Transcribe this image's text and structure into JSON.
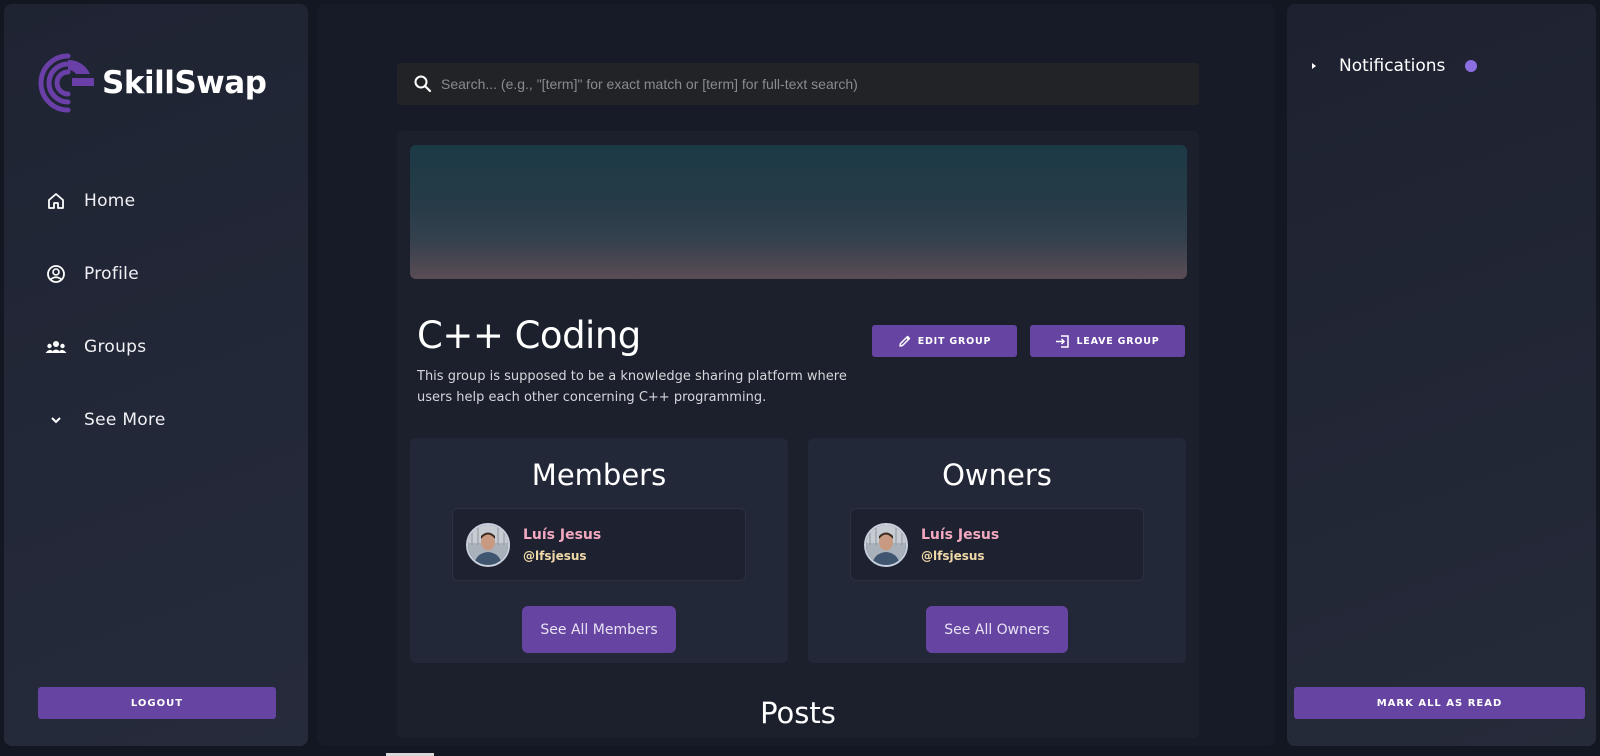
{
  "app": {
    "name": "SkillSwap",
    "accent_color": "#6644a2"
  },
  "sidebar": {
    "items": [
      {
        "label": "Home",
        "icon": "home-icon"
      },
      {
        "label": "Profile",
        "icon": "user-circle-icon"
      },
      {
        "label": "Groups",
        "icon": "users-icon"
      },
      {
        "label": "See More",
        "icon": "chevron-down-icon"
      }
    ],
    "logout_label": "LOGOUT"
  },
  "search": {
    "placeholder": "Search... (e.g., \"[term]\" for exact match or [term] for full-text search)",
    "value": ""
  },
  "group": {
    "title": "C++ Coding",
    "description": "This group is supposed to be a knowledge sharing platform where users help each other concerning C++ programming.",
    "edit_label": "EDIT GROUP",
    "leave_label": "LEAVE GROUP"
  },
  "members": {
    "title": "Members",
    "users": [
      {
        "name": "Luís Jesus",
        "handle": "@lfsjesus"
      }
    ],
    "see_all_label": "See All Members"
  },
  "owners": {
    "title": "Owners",
    "users": [
      {
        "name": "Luís Jesus",
        "handle": "@lfsjesus"
      }
    ],
    "see_all_label": "See All Owners"
  },
  "posts": {
    "title": "Posts"
  },
  "notifications": {
    "title": "Notifications",
    "mark_all_label": "MARK ALL AS READ",
    "unread_dot_color": "#8b6fe0"
  }
}
